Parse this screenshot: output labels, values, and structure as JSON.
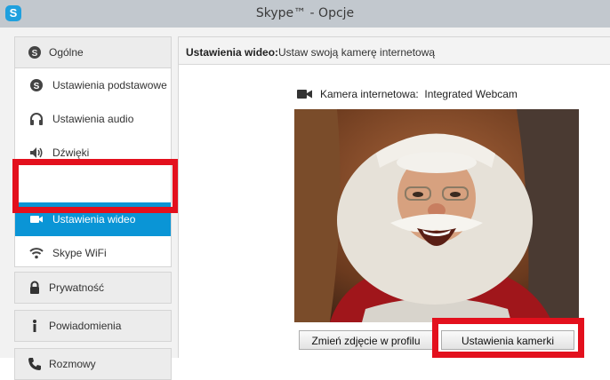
{
  "window": {
    "title": "Skype™ - Opcje",
    "logo_letter": "S"
  },
  "sidebar": {
    "categories": [
      {
        "label": "Ogólne",
        "icon": "skype-icon"
      },
      {
        "label": "Prywatność",
        "icon": "lock-icon"
      },
      {
        "label": "Powiadomienia",
        "icon": "info-icon"
      },
      {
        "label": "Rozmowy",
        "icon": "phone-icon"
      }
    ],
    "items": [
      {
        "label": "Ustawienia podstawowe",
        "icon": "skype-icon"
      },
      {
        "label": "Ustawienia audio",
        "icon": "headset-icon"
      },
      {
        "label": "Dźwięki",
        "icon": "speaker-icon"
      },
      {
        "label": "Ustawienia wideo",
        "icon": "video-camera-icon",
        "selected": true
      },
      {
        "label": "Skype WiFi",
        "icon": "wifi-icon"
      }
    ]
  },
  "main": {
    "header_title": "Ustawienia wideo:",
    "header_subtitle": "Ustaw swoją kamerę internetową",
    "webcam_label": "Kamera internetowa:",
    "webcam_name": "Integrated Webcam",
    "buttons": {
      "change_photo": "Zmień zdjęcie w profilu",
      "camera_settings": "Ustawienia kamerki"
    }
  },
  "colors": {
    "selected_bg": "#0a95d6",
    "highlight": "#e3101d",
    "titlebar": "#c2c8ce",
    "skype_blue": "#1fa0de"
  }
}
